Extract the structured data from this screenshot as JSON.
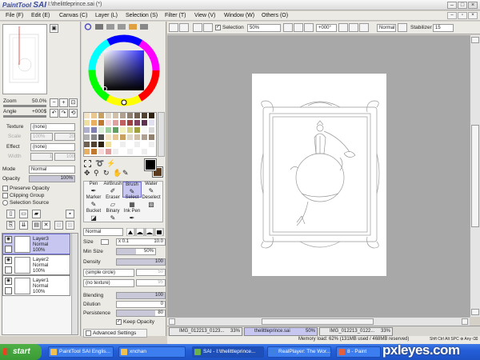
{
  "app": {
    "logo_prefix": "PaintTool",
    "logo_name": "SAI",
    "window_title": "I:\\thelittleprince.sai (*)"
  },
  "menu": [
    {
      "label": "File (F)"
    },
    {
      "label": "Edit (E)"
    },
    {
      "label": "Canvas (C)"
    },
    {
      "label": "Layer (L)"
    },
    {
      "label": "Selection (S)"
    },
    {
      "label": "Filter (T)"
    },
    {
      "label": "View (V)"
    },
    {
      "label": "Window (W)"
    },
    {
      "label": "Others (O)"
    }
  ],
  "navigator": {
    "zoom_label": "Zoom",
    "zoom_value": "50.0%",
    "angle_label": "Angle",
    "angle_value": "+000$"
  },
  "left": {
    "texture_label": "Texture",
    "texture_value": "(none)",
    "scale_label": "Scale",
    "scale_value": "100%",
    "scale_num": "20",
    "effect_label": "Effect",
    "effect_value": "(none)",
    "width_label": "Width",
    "width_value": "1",
    "width_num": "100",
    "mode_label": "Mode",
    "mode_value": "Normal",
    "opacity_label": "Opacity",
    "opacity_value": "100%",
    "preserve_opacity": "Preserve Opacity",
    "clipping_group": "Clipping Group",
    "selection_source": "Selection Source"
  },
  "layers": [
    {
      "name": "Layer3",
      "mode": "Normal",
      "opacity": "100%",
      "selected": true
    },
    {
      "name": "Layer2",
      "mode": "Normal",
      "opacity": "100%",
      "selected": false
    },
    {
      "name": "Layer1",
      "mode": "Normal",
      "opacity": "100%",
      "selected": false
    }
  ],
  "tools": {
    "row1": [
      "Pen",
      "AirBrush",
      "Brush",
      "Water"
    ],
    "row2": [
      "Marker",
      "Eraser",
      "Select",
      "Deselect"
    ],
    "row3": [
      "Bucket",
      "Binary",
      "Ink Pen",
      ""
    ],
    "selected": "Brush"
  },
  "brush": {
    "blend_mode": "Normal",
    "size_label": "Size",
    "size_mult": "x 0.1",
    "size_value": "10.0",
    "min_size_label": "Min Size",
    "min_size_value": "50%",
    "density_label": "Density",
    "density_value": "100",
    "shape_value": "(simple circle)",
    "shape_num": "50",
    "texture_value": "(no texture)",
    "texture_num": "95",
    "blending_label": "Blending",
    "blending_value": "100",
    "dilution_label": "Dilution",
    "dilution_value": "0",
    "persistence_label": "Persistence",
    "persistence_value": "80",
    "keep_opacity": "Keep Opacity",
    "advanced_settings": "Advanced Settings"
  },
  "toolbar": {
    "selection_label": "Selection",
    "zoom_value": "50%",
    "angle_value": "+000°",
    "mode_value": "Normal",
    "stabilizer_label": "Stabilizer",
    "stabilizer_value": "15"
  },
  "tabs": [
    {
      "label": "IMG_012213_0123...",
      "pct": "33%",
      "active": false
    },
    {
      "label": "thelittleprince.sai",
      "pct": "50%",
      "active": true
    },
    {
      "label": "IMG_012213_0122...",
      "pct": "33%",
      "active": false
    }
  ],
  "status": {
    "memory": "Memory load: 62% (131MB used / 468MB reserved)",
    "keys": "Shft Ctrl Alt SPC ⊕ Any ⌫"
  },
  "taskbar": {
    "start": "start",
    "tasks": [
      {
        "label": "PaintTool SAI Englis..."
      },
      {
        "label": "xnchan"
      },
      {
        "label": "SAI - I:\\thelittleprince..."
      },
      {
        "label": "RealPlayer: The Wor..."
      },
      {
        "label": "8 - Paint"
      }
    ]
  },
  "watermark": "pxleyes.com",
  "colors": {
    "accent_selected": "#c6c6f0",
    "canvas_bg": "#a8a8a8",
    "taskbar": "#245ed8",
    "start_green": "#3a9a34",
    "primary_color": "#000000",
    "secondary_color": "#5a3a1a"
  }
}
